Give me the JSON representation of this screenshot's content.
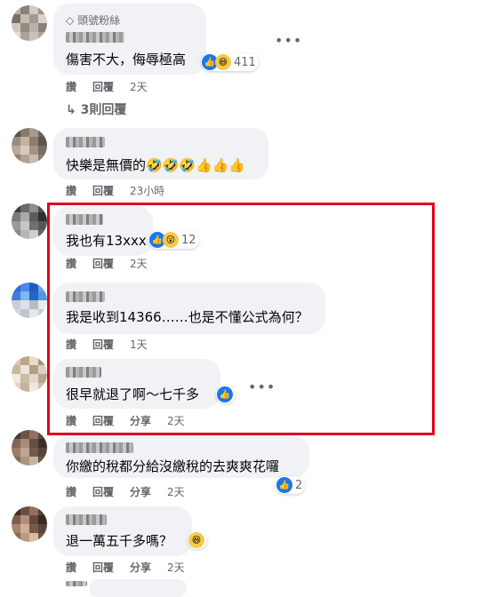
{
  "comments": [
    {
      "badge": "頭號粉絲",
      "text": "傷害不大，侮辱極高",
      "actions": [
        "讚",
        "回覆"
      ],
      "time": "2天",
      "reactions": "411",
      "replies": "3則回覆"
    },
    {
      "text": "快樂是無價的🤣🤣🤣👍👍👍",
      "actions": [
        "讚",
        "回覆"
      ],
      "time": "23小時"
    },
    {
      "text": "我也有13xxx",
      "actions": [
        "讚",
        "回覆"
      ],
      "time": "2天",
      "reactions": "12"
    },
    {
      "text": "我是收到14366……也是不懂公式為何？",
      "actions": [
        "讚",
        "回覆"
      ],
      "time": "1天"
    },
    {
      "text": "很早就退了啊～七千多",
      "actions": [
        "讚",
        "回覆",
        "分享"
      ],
      "time": "2天"
    },
    {
      "text": "你繳的稅都分給沒繳稅的去爽爽花囉",
      "actions": [
        "讚",
        "回覆",
        "分享"
      ],
      "time": "2天",
      "reactions": "2"
    },
    {
      "text": "退一萬五千多嗎？",
      "actions": [
        "讚",
        "回覆",
        "分享"
      ],
      "time": "2天"
    }
  ],
  "colors": {
    "highlight": "#e0001b",
    "like": "#1877f2",
    "bubble": "#f0f2f5"
  },
  "icons": {
    "more": "more-dots-icon",
    "badge": "diamond-icon",
    "reply_arrow": "reply-arrow-icon"
  }
}
